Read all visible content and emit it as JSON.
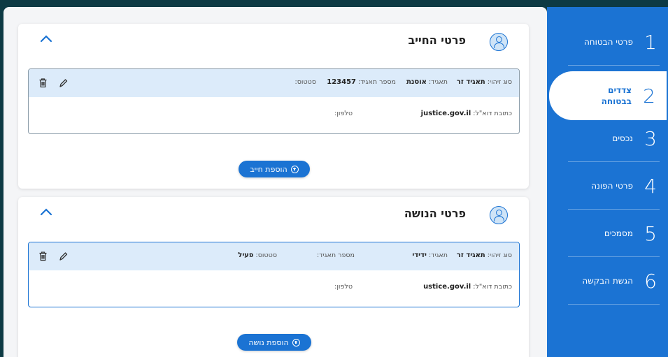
{
  "sidebar": {
    "steps": [
      {
        "num": "1",
        "label": "פרטי הבטוחה"
      },
      {
        "num": "2",
        "label": "צדדים בבטוחה"
      },
      {
        "num": "3",
        "label": "נכסים"
      },
      {
        "num": "4",
        "label": "פרטי הפונה"
      },
      {
        "num": "5",
        "label": "מסמכים"
      },
      {
        "num": "6",
        "label": "הגשת הבקשה"
      }
    ],
    "active_step": "2"
  },
  "debtor": {
    "title": "פרטי החייב",
    "record": {
      "id_type_label": "סוג זיהוי:",
      "id_type_value": "תאגיד זר",
      "corp_label": "תאגיד:",
      "corp_value": "אוסנת",
      "corp_num_label": "מספר תאגיד:",
      "corp_num_value": "123457",
      "status_label": "סטטוס:",
      "status_value": "",
      "email_label": "כתובת דוא\"ל:",
      "email_value": "justice.gov.il",
      "phone_label": "טלפון:",
      "phone_value": ""
    },
    "add_button": "הוספת חייב"
  },
  "creditor": {
    "title": "פרטי הנושה",
    "record": {
      "id_type_label": "סוג זיהוי:",
      "id_type_value": "תאגיד זר",
      "corp_label": "תאגיד:",
      "corp_value": "ידידי",
      "corp_num_label": "מספר תאגיד:",
      "corp_num_value": "",
      "status_label": "סטטוס:",
      "status_value": "פעיל",
      "email_label": "כתובת דוא\"ל:",
      "email_value": "ustice.gov.il",
      "phone_label": "טלפון:",
      "phone_value": ""
    },
    "add_button": "הוספת נושה"
  },
  "colors": {
    "sidebar_bg": "#1b73d3",
    "page_bg": "#0d3a44",
    "record_header_bg": "#dcebfa",
    "accent": "#1b73d3"
  },
  "icons": [
    "user-avatar-icon",
    "chevron-up-icon",
    "trash-icon",
    "pencil-icon",
    "plus-circle-icon"
  ]
}
